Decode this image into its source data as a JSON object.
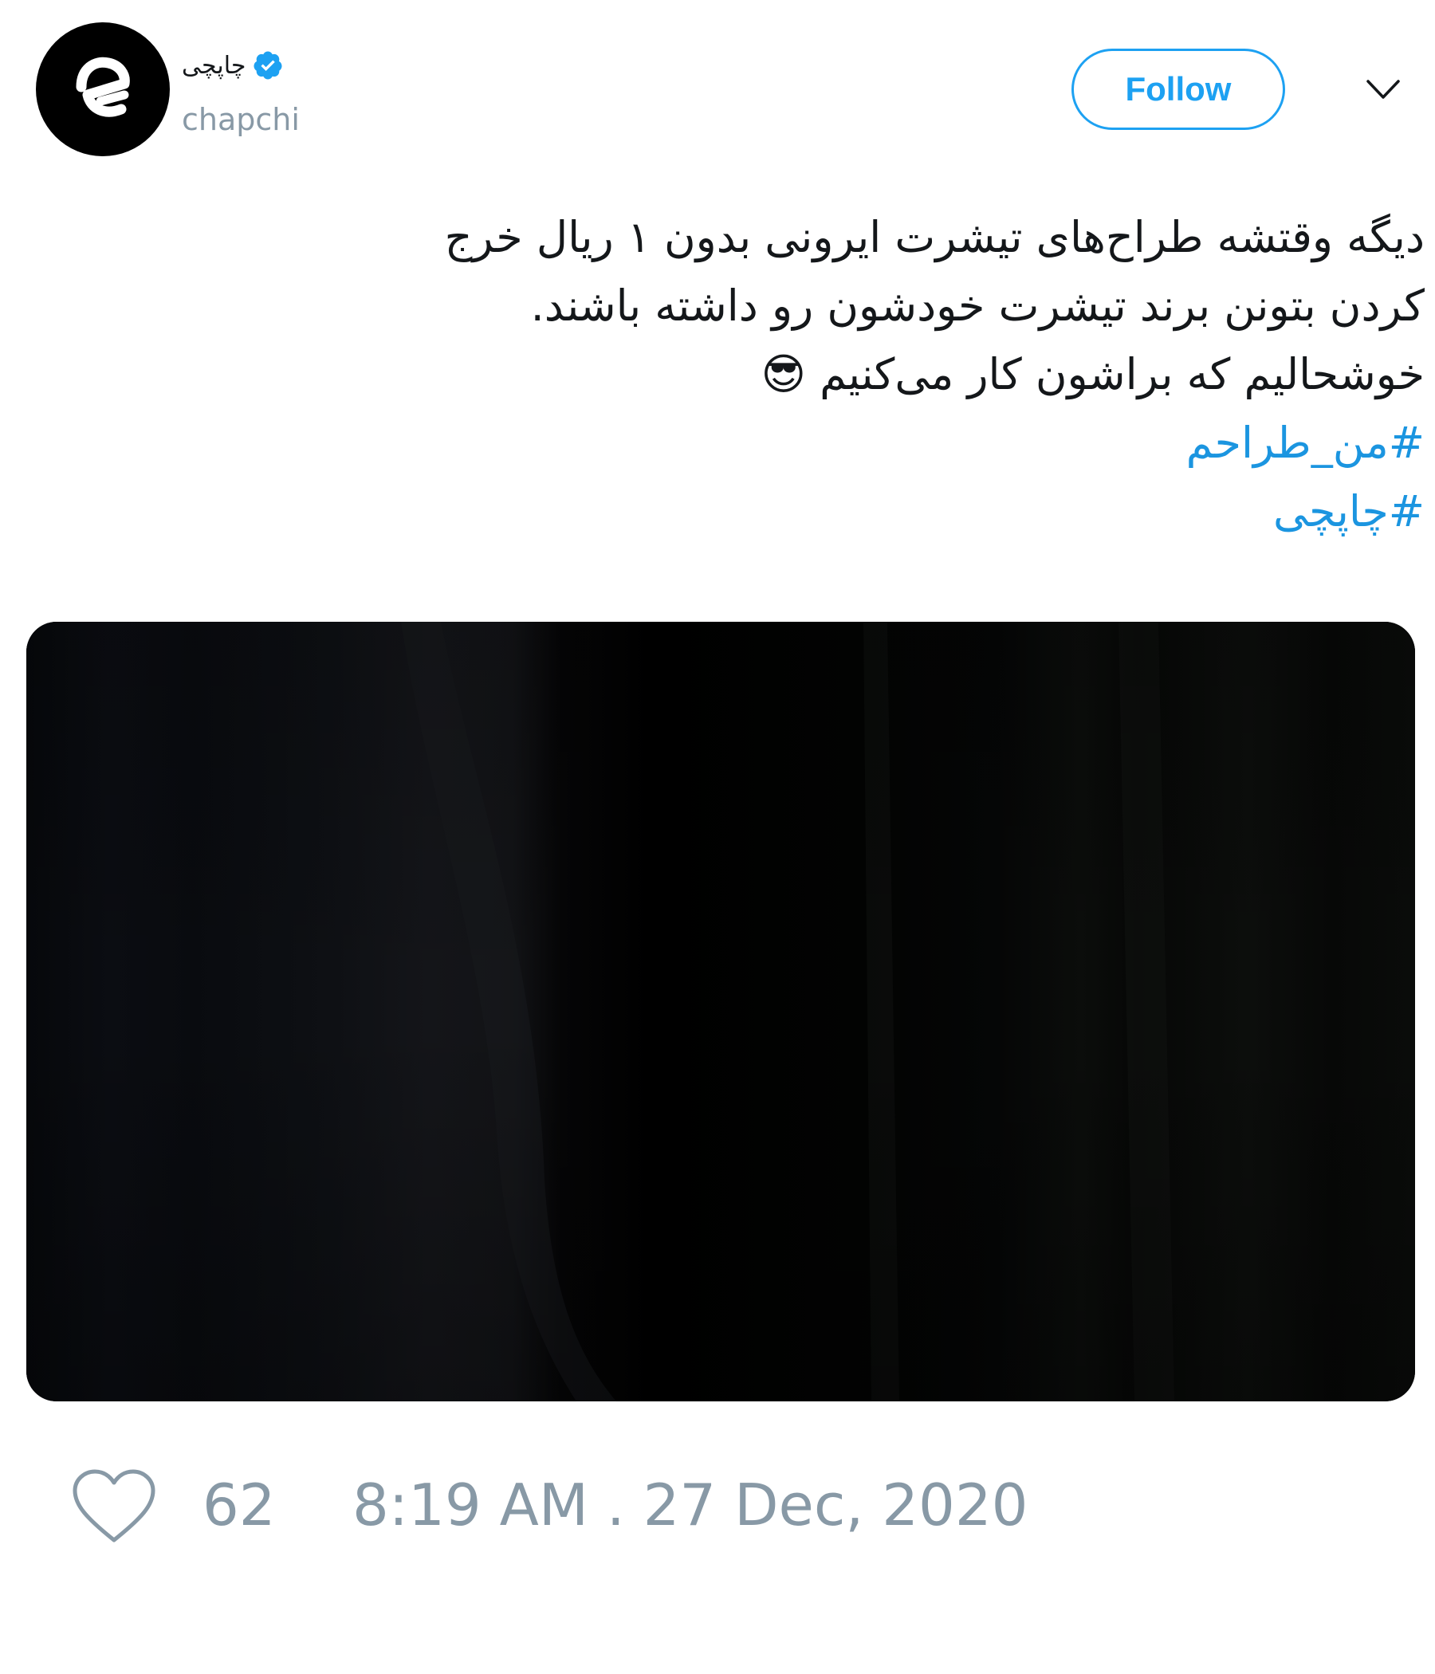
{
  "tweet": {
    "author": {
      "display_name": "چاپچی",
      "handle": "chapchi",
      "verified": true,
      "avatar_icon": "chapchi-logo-icon"
    },
    "follow_label": "Follow",
    "menu_icon": "chevron-down-icon",
    "text_lines": [
      "دیگه وقتشه طراح‌های تیشرت ایرونی بدون ۱ ریال خرج",
      "کردن بتونن برند تیشرت خودشون رو داشته باشند.",
      "خوشحالیم که براشون کار می‌کنیم 😎"
    ],
    "hashtags": [
      "#من_طراحم",
      "#چاپچی"
    ],
    "media": {
      "type": "image"
    },
    "like_icon": "heart-icon",
    "like_count": "62",
    "timestamp": "8:19 AM . 27 Dec, 2020"
  },
  "colors": {
    "accent": "#1da1f2",
    "hashtag": "#1b95e0",
    "muted": "#8899a6",
    "text": "#14171a",
    "media_bg": "#000000"
  }
}
